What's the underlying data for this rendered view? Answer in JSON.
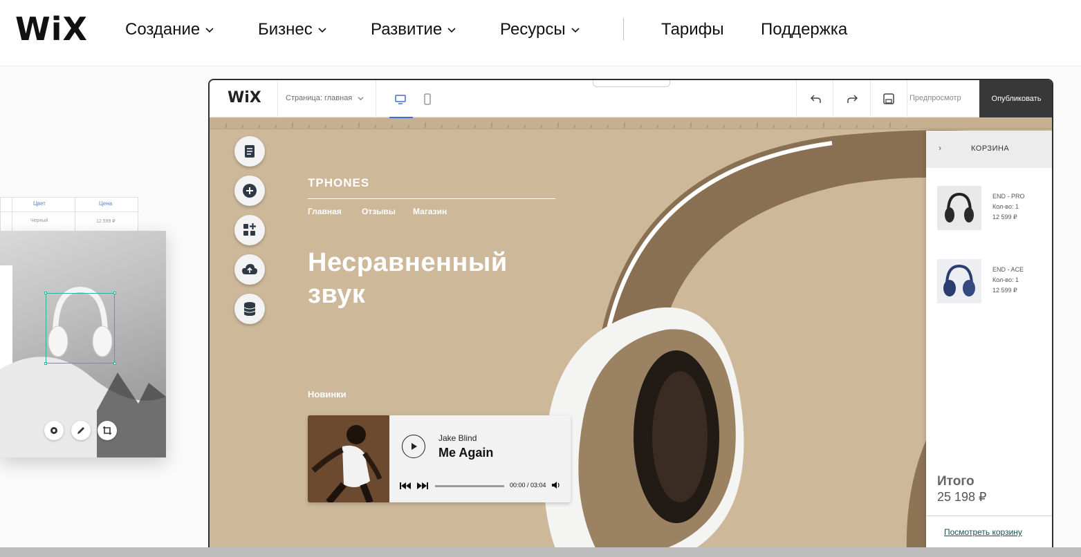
{
  "topnav": {
    "logo": "WiX",
    "items": [
      {
        "label": "Создание",
        "has_dropdown": true
      },
      {
        "label": "Бизнес",
        "has_dropdown": true
      },
      {
        "label": "Развитие",
        "has_dropdown": true
      },
      {
        "label": "Ресурсы",
        "has_dropdown": true
      },
      {
        "label": "Тарифы",
        "has_dropdown": false
      },
      {
        "label": "Поддержка",
        "has_dropdown": false
      }
    ]
  },
  "left_mock": {
    "table_headers": [
      "Цвет",
      "Цена"
    ],
    "table_cells": [
      "Черный",
      "12 599 ₽"
    ],
    "image_tools": [
      "gear-icon",
      "pen-icon",
      "crop-icon"
    ]
  },
  "editor": {
    "logo": "WiX",
    "page_selector": "Страница: главная",
    "devices": [
      "desktop-icon",
      "mobile-icon"
    ],
    "active_device": "desktop",
    "actions": [
      "undo-icon",
      "redo-icon",
      "save-icon"
    ],
    "preview_label": "Предпросмотр",
    "publish_label": "Опубликовать"
  },
  "side_tools": [
    "pages-icon",
    "add-icon",
    "apps-icon",
    "upload-icon",
    "database-icon"
  ],
  "site": {
    "brand": "TPHONES",
    "links": [
      "Главная",
      "Отзывы",
      "Магазин"
    ],
    "hero_line1": "Несравненный",
    "hero_line2": "звук",
    "section_label": "Новинки",
    "background_color": "#cdb89a"
  },
  "player": {
    "artist": "Jake Blind",
    "track": "Me Again",
    "time": "00:00 / 03:04",
    "progress": 0
  },
  "cart": {
    "title": "КОРЗИНА",
    "items": [
      {
        "name": "END - PRO",
        "qty": "Кол-во: 1",
        "price": "12 599 ₽"
      },
      {
        "name": "END - ACE",
        "qty": "Кол-во: 1",
        "price": "12 599 ₽"
      }
    ],
    "total_label": "Итого",
    "total_value": "25 198 ₽",
    "view_cart": "Посмотреть корзину"
  }
}
